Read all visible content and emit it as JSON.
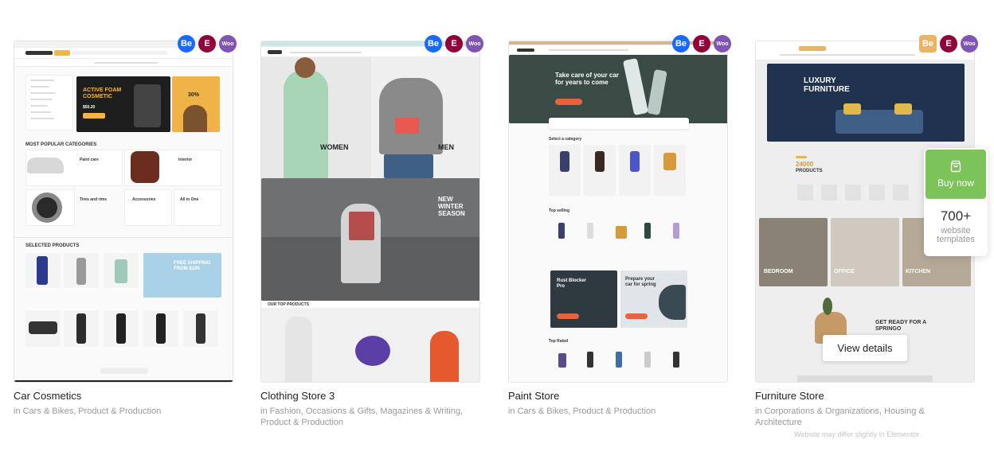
{
  "cards": [
    {
      "title": "Car Cosmetics",
      "categories": "in Cars & Bikes, Product & Production",
      "preview": {
        "promo": "ACTIVE FOAM COSMETIC",
        "promo_price": "$50.20",
        "side_promo": "30%",
        "section1": "MOST POPULAR CATEGORIES",
        "cat1": "Paint care",
        "cat2": "Interior",
        "cat3": "Tires and rims",
        "cat4": "Accessories",
        "cat5": "All in One",
        "section2": "SELECTED PRODUCTS",
        "banner": "FREE SHIPPING FROM $109"
      }
    },
    {
      "title": "Clothing Store 3",
      "categories": "in Fashion, Occasions & Gifts, Magazines & Writing, Product & Production",
      "preview": {
        "women": "WOMEN",
        "men": "MEN",
        "season": "NEW WINTER SEASON",
        "section": "OUR TOP PRODUCTS"
      }
    },
    {
      "title": "Paint Store",
      "categories": "in Cars & Bikes, Product & Production",
      "preview": {
        "hero": "Take care of your car for years to come",
        "section1": "Select a category",
        "section2": "Top selling",
        "promo1": "Rust Blocker Pro",
        "promo2": "Prepare your car for spring",
        "section3": "Top Rated"
      }
    },
    {
      "title": "Furniture Store",
      "categories": "in Corporations & Organizations, Housing & Architecture",
      "preview": {
        "hero": "LUXURY FURNITURE",
        "count": "24000",
        "count_label": "PRODUCTS",
        "room1": "BEDROOM",
        "room2": "OFFICE",
        "room3": "KITCHEN",
        "promo": "GET READY FOR A SPRINGO"
      }
    }
  ],
  "badges": {
    "behance": "Be",
    "elementor": "E",
    "woo": "Woo"
  },
  "buy_now": {
    "label": "Buy now",
    "count": "700+",
    "subtitle": "website templates",
    "icon": "shopping-bag-icon"
  },
  "view_details": "View details",
  "disclaimer": "Website may differ slightly in Elementor",
  "colors": {
    "behance": "#1769ff",
    "elementor": "#92003b",
    "woo": "#7f54b3",
    "buy": "#7cc35a",
    "paint_dark": "#3a4a44",
    "orange": "#e8623a",
    "furniture_navy": "#20324f"
  }
}
